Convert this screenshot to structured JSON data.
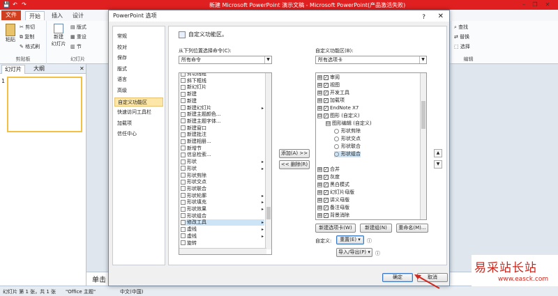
{
  "window": {
    "title": "新建 Microsoft PowerPoint 演示文稿 - Microsoft PowerPoint(产品激活失败)",
    "qat": [
      "💾",
      "↶",
      "↷"
    ],
    "controls": [
      "–",
      "❐",
      "✕"
    ]
  },
  "ribbon": {
    "tabs": [
      "文件",
      "开始",
      "插入",
      "设计"
    ],
    "groups": {
      "clipboard": {
        "label": "剪贴板",
        "paste": "粘贴",
        "cut": "剪切",
        "copy": "复制",
        "format_painter": "格式刷"
      },
      "slides": {
        "label": "幻灯片",
        "new_slide": "新建",
        "new_slide2": "幻灯片",
        "layout": "版式",
        "reset": "重设",
        "section": "节"
      },
      "editing": {
        "label": "编辑",
        "find": "查找",
        "replace": "替换",
        "select": "选择"
      }
    }
  },
  "left_pane": {
    "tabs": [
      "幻灯片",
      "大纲"
    ],
    "slide_number": "1"
  },
  "notes": {
    "placeholder": "单击"
  },
  "statusbar": {
    "slide_info": "幻灯片 第 1 张，共 1 张",
    "theme": "\"Office 主题\"",
    "language": "中文(中国)"
  },
  "dialog": {
    "title": "PowerPoint 选项",
    "help": "?",
    "close": "✕",
    "nav": [
      "常规",
      "校对",
      "保存",
      "版式",
      "语言",
      "高级",
      "自定义功能区",
      "快速访问工具栏",
      "加载项",
      "信任中心"
    ],
    "nav_selected": 6,
    "header": "自定义功能区。",
    "from_label": "从下列位置选择命令(C):",
    "from_value": "所有命令",
    "customize_label": "自定义功能区(B):",
    "customize_value": "所有选项卡",
    "commands": [
      {
        "text": "剪切线框"
      },
      {
        "text": "斜下框线"
      },
      {
        "text": "新幻灯片"
      },
      {
        "text": "新建"
      },
      {
        "text": "新建"
      },
      {
        "text": "新建幻灯片",
        "sub": "▸"
      },
      {
        "text": "新建主题颜色..."
      },
      {
        "text": "新建主题字体..."
      },
      {
        "text": "新建窗口"
      },
      {
        "text": "新建批注"
      },
      {
        "text": "新建相册..."
      },
      {
        "text": "新增节"
      },
      {
        "text": "信息检索..."
      },
      {
        "text": "形状",
        "sub": "▸"
      },
      {
        "text": "形状",
        "sub": "▸"
      },
      {
        "text": "形状剪除"
      },
      {
        "text": "形状交点"
      },
      {
        "text": "形状联合"
      },
      {
        "text": "形状轮廓",
        "sub": "▸"
      },
      {
        "text": "形状填充",
        "sub": "▸"
      },
      {
        "text": "形状效果",
        "sub": "▸"
      },
      {
        "text": "形状组合"
      },
      {
        "text": "修改工具",
        "sub": "▸",
        "sel": true
      },
      {
        "text": "虚线",
        "sub": "▸"
      },
      {
        "text": "虚线",
        "sub": "▸"
      },
      {
        "text": "旋转"
      }
    ],
    "add_button": "添加(A) >>",
    "remove_button": "<< 删除(R)",
    "tabs_tree": [
      {
        "text": "审阅",
        "level": 0,
        "exp": "⊞",
        "chk": true
      },
      {
        "text": "视图",
        "level": 0,
        "exp": "⊞",
        "chk": true
      },
      {
        "text": "开发工具",
        "level": 0,
        "exp": "⊞",
        "chk": true
      },
      {
        "text": "加载项",
        "level": 0,
        "exp": "⊞",
        "chk": true
      },
      {
        "text": "EndNote X7",
        "level": 0,
        "exp": "⊞",
        "chk": true
      },
      {
        "text": "图形 (自定义)",
        "level": 0,
        "exp": "⊟",
        "chk": true
      },
      {
        "text": "图形编辑 (自定义)",
        "level": 1,
        "exp": "⊟",
        "chk": false
      },
      {
        "text": "形状剪除",
        "level": 2,
        "exp": "",
        "chk": false
      },
      {
        "text": "形状交点",
        "level": 2,
        "exp": "",
        "chk": false
      },
      {
        "text": "形状联合",
        "level": 2,
        "exp": "",
        "chk": false
      },
      {
        "text": "形状组合",
        "level": 2,
        "exp": "",
        "chk": false,
        "sel": true
      },
      {
        "text": "",
        "level": 0,
        "exp": "",
        "chk": false
      },
      {
        "text": "合并",
        "level": 0,
        "exp": "⊞",
        "chk": true
      },
      {
        "text": "灰度",
        "level": 0,
        "exp": "⊞",
        "chk": true
      },
      {
        "text": "黑白模式",
        "level": 0,
        "exp": "⊞",
        "chk": true
      },
      {
        "text": "幻灯片母版",
        "level": 0,
        "exp": "⊞",
        "chk": true
      },
      {
        "text": "讲义母版",
        "level": 0,
        "exp": "⊞",
        "chk": true
      },
      {
        "text": "备注母版",
        "level": 0,
        "exp": "⊞",
        "chk": true
      },
      {
        "text": "背景消除",
        "level": 0,
        "exp": "⊞",
        "chk": true
      }
    ],
    "new_tab_button": "新建选项卡(W)",
    "new_group_button": "新建组(N)",
    "rename_button": "重命名(M)...",
    "custom_label": "自定义:",
    "reset_button": "重置(E) ▾",
    "import_export_button": "导入/导出(P) ▾",
    "ok_button": "确定",
    "cancel_button": "取消"
  },
  "watermark": {
    "title": "易采站长站",
    "url": "www.easck.com"
  }
}
